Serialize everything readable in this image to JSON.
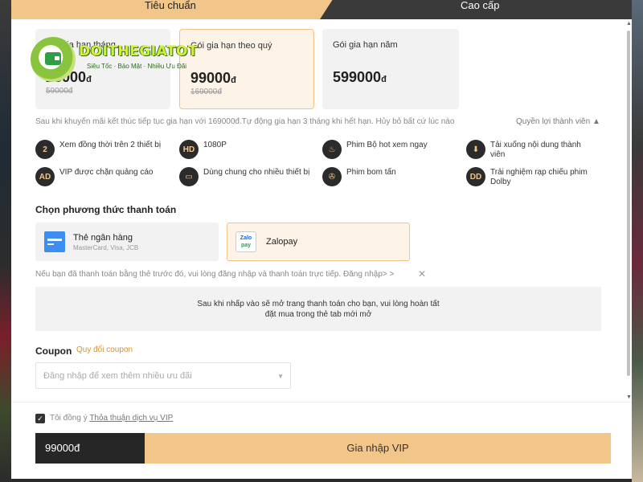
{
  "tabs": {
    "standard": "Tiêu chuẩn",
    "premium": "Cao cấp"
  },
  "logo": {
    "title": "DOITHEGIATOT",
    "subtitle": "Siêu Tốc · Bảo Mật · Nhiều Ưu Đãi"
  },
  "plans": [
    {
      "name": "Gói gia hạn tháng",
      "price": "23000",
      "currency": "đ",
      "old_price": "59000đ",
      "selected": false
    },
    {
      "name": "Gói gia hạn theo quý",
      "price": "99000",
      "currency": "đ",
      "old_price": "169000đ",
      "selected": true
    },
    {
      "name": "Gói gia hạn năm",
      "price": "599000",
      "currency": "đ",
      "old_price": "",
      "selected": false
    }
  ],
  "renewal_note": "Sau khi khuyến mãi kết thúc tiếp tục gia hạn với 169000đ.Tự động gia hạn 3 tháng khi hết hạn. Hủy bỏ bất cứ lúc nào",
  "benefits_link": "Quyền lợi thành viên",
  "features": [
    {
      "icon": "two-devices-icon",
      "glyph": "2",
      "label": "Xem đồng thời trên 2 thiết bị"
    },
    {
      "icon": "hd-icon",
      "glyph": "HD",
      "label": "1080P"
    },
    {
      "icon": "fire-icon",
      "glyph": "♨",
      "label": "Phim Bộ hot xem ngay"
    },
    {
      "icon": "download-icon",
      "glyph": "⬇",
      "label": "Tải xuống nội dung thành viên"
    },
    {
      "icon": "ad-block-icon",
      "glyph": "AD",
      "label": "VIP được chặn quảng cáo"
    },
    {
      "icon": "tv-icon",
      "glyph": "▭",
      "label": "Dùng chung cho nhiều thiết bị"
    },
    {
      "icon": "film-reel-icon",
      "glyph": "✇",
      "label": "Phim bom tấn"
    },
    {
      "icon": "dolby-icon",
      "glyph": "DD",
      "label": "Trải nghiệm rạp chiếu phim Dolby"
    }
  ],
  "payment_section_title": "Chọn phương thức thanh toán",
  "payments": {
    "bank": {
      "name": "Thẻ ngân hàng",
      "sub": "MasterCard, Visa, JCB"
    },
    "zalopay": {
      "name": "Zalopay",
      "icon_top": "Zalo",
      "icon_bottom": "pay"
    }
  },
  "login_note": "Nếu bạn đã thanh toán bằng thẻ trước đó, vui lòng đăng nhập và thanh toán trực tiếp. Đăng nhập> >",
  "info_box": {
    "line1": "Sau khi nhấp vào sẽ mở trang thanh toán cho bạn, vui lòng hoàn tất",
    "line2": "đặt mua trong thẻ tab mới mở"
  },
  "coupon": {
    "label": "Coupon",
    "link": "Quy đổi coupon",
    "placeholder": "Đăng nhập để xem thêm nhiều ưu đãi"
  },
  "footer": {
    "agree_prefix": "Tôi đồng ý",
    "agree_link": "Thỏa thuận dịch vụ VIP",
    "total": "99000đ",
    "buy_button": "Gia nhập VIP"
  },
  "colors": {
    "accent": "#f2c689",
    "dark": "#262626",
    "link": "#e0902a"
  }
}
